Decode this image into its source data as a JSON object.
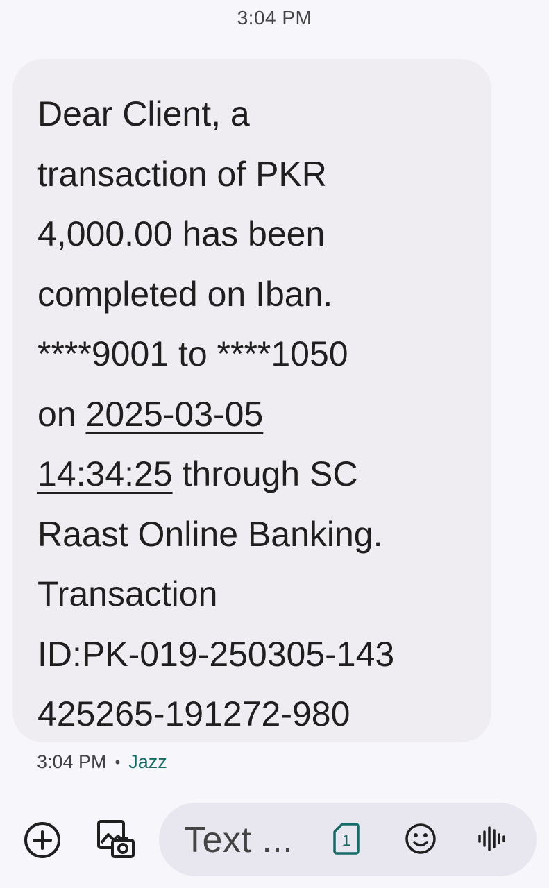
{
  "header": {
    "timestamp": "3:04 PM"
  },
  "message": {
    "lines": [
      "Dear Client, a",
      "transaction of PKR",
      "4,000.00 has been",
      "completed on Iban.",
      "****9001 to ****1050"
    ],
    "line6_prefix": "on ",
    "date_link": "2025-03-05",
    "time_link": "14:34:25",
    "line7_suffix": " through SC",
    "lines_after": [
      "Raast Online Banking.",
      "Transaction",
      "ID:PK-019-250305-143",
      "425265-191272-980"
    ]
  },
  "meta": {
    "time": "3:04 PM",
    "separator": "•",
    "sim": "Jazz"
  },
  "compose": {
    "placeholder": "Text ...",
    "sim_number": "1"
  },
  "icons": {
    "add": "add-circle-icon",
    "media": "gallery-camera-icon",
    "sim": "sim-card-icon",
    "emoji": "emoji-icon",
    "voice": "voice-waveform-icon"
  },
  "colors": {
    "background": "#f6f6fb",
    "bubble": "#efedf1",
    "input_pill": "#e8e6ee",
    "accent": "#146c66"
  }
}
